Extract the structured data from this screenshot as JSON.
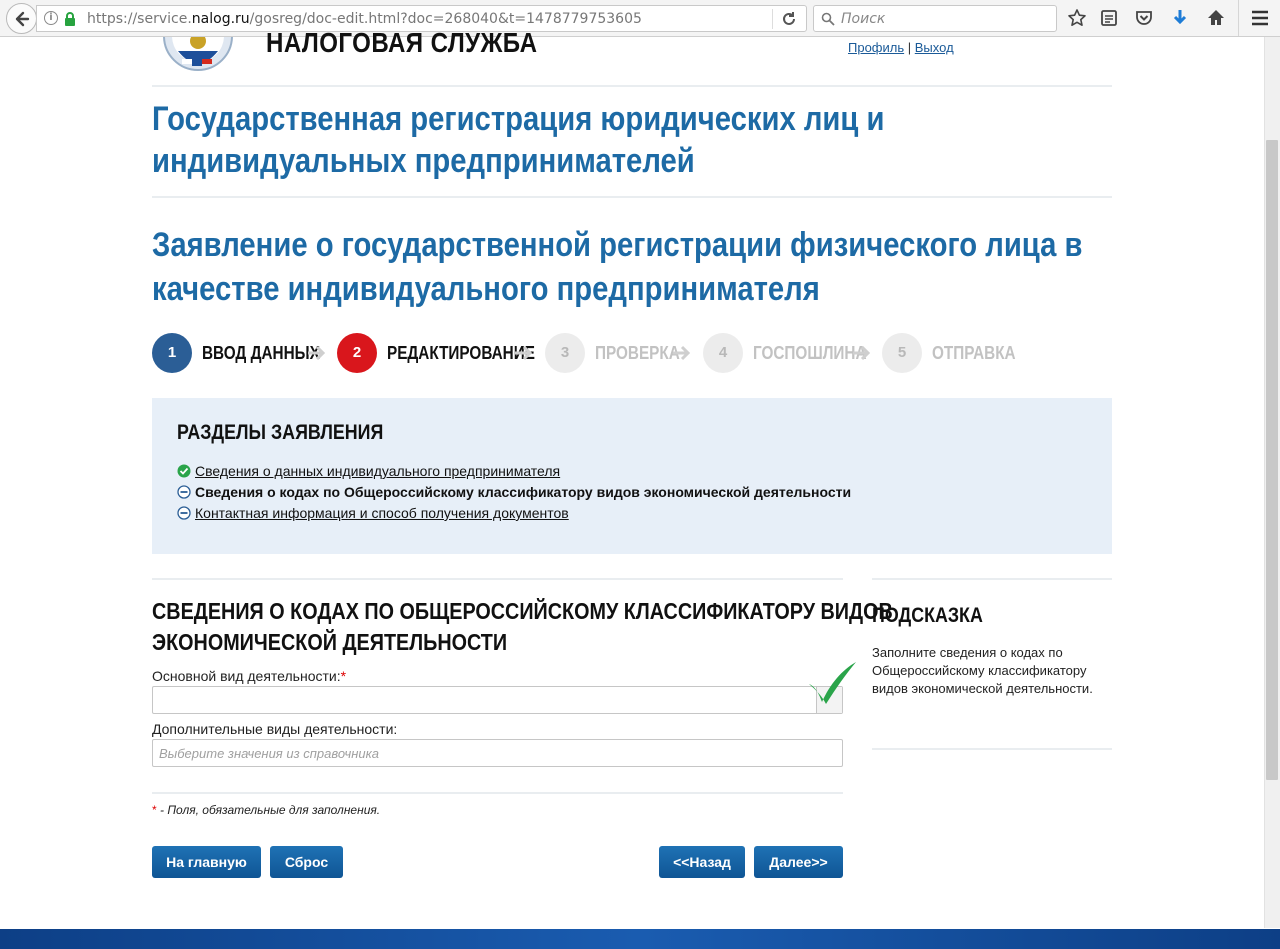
{
  "browser": {
    "url_prefix": "https://service.",
    "url_domain": "nalog.ru",
    "url_suffix": "/gosreg/doc-edit.html?doc=268040&t=1478779753605",
    "search_placeholder": "Поиск"
  },
  "header": {
    "logo_title": "НАЛОГОВАЯ СЛУЖБА",
    "profile_link": "Профиль",
    "separator": "|",
    "logout_link": "Выход"
  },
  "page": {
    "title_line1": "Государственная регистрация юридических лиц и",
    "title_line2": "индивидуальных предпринимателей",
    "subtitle_line1": "Заявление о государственной регистрации физического лица в",
    "subtitle_line2": "качестве индивидуального предпринимателя"
  },
  "steps": [
    {
      "num": "1",
      "label": "ВВОД ДАННЫХ",
      "state": "done"
    },
    {
      "num": "2",
      "label": "РЕДАКТИРОВАНИЕ",
      "state": "active"
    },
    {
      "num": "3",
      "label": "ПРОВЕРКА",
      "state": "pending"
    },
    {
      "num": "4",
      "label": "ГОСПОШЛИНА",
      "state": "pending"
    },
    {
      "num": "5",
      "label": "ОТПРАВКА",
      "state": "pending"
    }
  ],
  "sections": {
    "title": "РАЗДЕЛЫ ЗАЯВЛЕНИЯ",
    "items": [
      {
        "label": "Сведения о данных индивидуального предпринимателя",
        "status": "complete"
      },
      {
        "label": "Сведения о кодах по Общероссийскому классификатору видов экономической деятельности",
        "status": "current"
      },
      {
        "label": "Контактная информация и способ получения документов",
        "status": "incomplete"
      }
    ]
  },
  "form": {
    "title_line1": "СВЕДЕНИЯ О КОДАХ ПО ОБЩЕРОССИЙСКОМУ КЛАССИФИКАТОРУ ВИДОВ",
    "title_line2": "ЭКОНОМИЧЕСКОЙ ДЕЯТЕЛЬНОСТИ",
    "main_activity_label": "Основной вид деятельности:",
    "required_mark": "*",
    "main_activity_value": "",
    "additional_activity_label": "Дополнительные виды деятельности:",
    "additional_activity_placeholder": "Выберите значения из справочника",
    "required_note": "- Поля, обязательные для заполнения."
  },
  "buttons": {
    "home": "На главную",
    "reset": "Сброс",
    "back": "<<Назад",
    "next": "Далее>>"
  },
  "hint": {
    "title": "ПОДСКАЗКА",
    "text": "Заполните сведения о кодах по Общероссийскому классификатору видов экономической деятельности."
  },
  "colors": {
    "accent_blue": "#1d6aa5",
    "step_done": "#2b5e96",
    "step_active": "#d9161c",
    "step_pending": "#e9e9e9",
    "check_green": "#2aa44a"
  }
}
